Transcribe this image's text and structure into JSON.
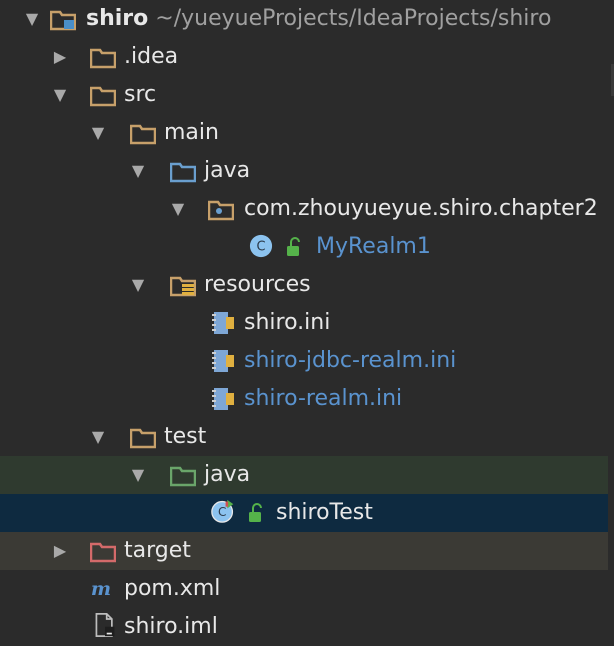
{
  "project": {
    "name": "shiro",
    "path": "~/yueyueProjects/IdeaProjects/shiro"
  },
  "tree": {
    "idea": ".idea",
    "src": "src",
    "main": "main",
    "main_java": "java",
    "package": "com.zhouyueyue.shiro.chapter2",
    "myrealm": "MyRealm1",
    "resources": "resources",
    "shiro_ini": "shiro.ini",
    "shiro_jdbc_ini": "shiro-jdbc-realm.ini",
    "shiro_realm_ini": "shiro-realm.ini",
    "test": "test",
    "test_java": "java",
    "shiro_test": "shiroTest",
    "target": "target",
    "pom": "pom.xml",
    "iml": "shiro.iml"
  },
  "colors": {
    "folder": "#c7a06a",
    "source_folder": "#6a9fcf",
    "test_folder": "#6aa56a",
    "excluded_folder": "#d46a6a",
    "link_text": "#5a93cf",
    "selection": "#0e2a40"
  }
}
